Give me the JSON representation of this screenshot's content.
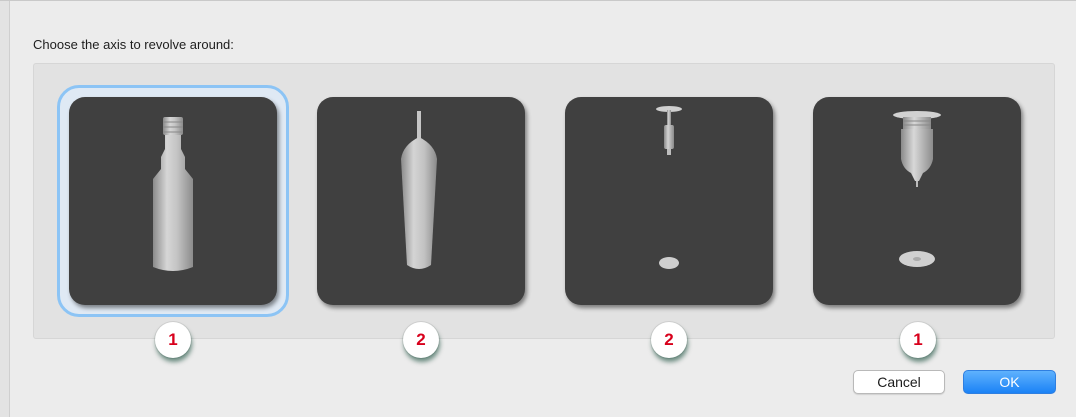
{
  "dialog": {
    "prompt": "Choose the axis to revolve around:",
    "options": [
      {
        "shape": "bottle-icon",
        "selected": true,
        "marker": "1"
      },
      {
        "shape": "tapered-candle-icon",
        "selected": false,
        "marker": "2"
      },
      {
        "shape": "pin-and-disc-icon",
        "selected": false,
        "marker": "2"
      },
      {
        "shape": "nozzle-and-disc-icon",
        "selected": false,
        "marker": "1"
      }
    ],
    "cancel_label": "Cancel",
    "ok_label": "OK"
  },
  "colors": {
    "tile": "#404040",
    "selection": "#8cc4f5",
    "marker_text": "#d8001c",
    "ok_button": "#1b82f6"
  }
}
